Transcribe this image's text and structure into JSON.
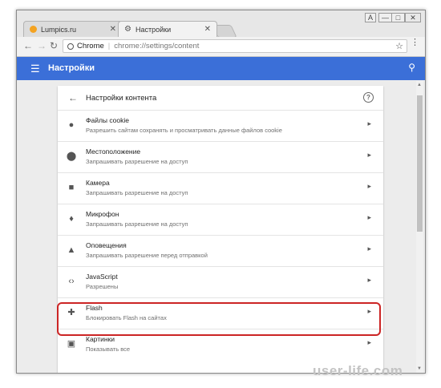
{
  "tabs": [
    {
      "title": "Lumpics.ru",
      "favicon": "lumpics-favicon-icon",
      "active": false,
      "color": "#f4a321"
    },
    {
      "title": "Настройки",
      "favicon": "gear-icon",
      "active": true
    }
  ],
  "window_controls": {
    "user": "A",
    "minimize": "—",
    "maximize": "□",
    "close": "✕"
  },
  "toolbar": {
    "site_name": "Chrome",
    "url": "chrome://settings/content",
    "separator": "|"
  },
  "header": {
    "title": "Настройки"
  },
  "card": {
    "title": "Настройки контента"
  },
  "rows": [
    {
      "icon": "cookie-icon",
      "label": "Файлы cookie",
      "desc": "Разрешить сайтам сохранять и просматривать данные файлов cookie"
    },
    {
      "icon": "location-pin-icon",
      "label": "Местоположение",
      "desc": "Запрашивать разрешение на доступ"
    },
    {
      "icon": "camera-icon",
      "label": "Камера",
      "desc": "Запрашивать разрешение на доступ"
    },
    {
      "icon": "microphone-icon",
      "label": "Микрофон",
      "desc": "Запрашивать разрешение на доступ"
    },
    {
      "icon": "bell-icon",
      "label": "Оповещения",
      "desc": "Запрашивать разрешение перед отправкой"
    },
    {
      "icon": "code-icon",
      "label": "JavaScript",
      "desc": "Разрешены"
    },
    {
      "icon": "puzzle-icon",
      "label": "Flash",
      "desc": "Блокировать Flash на сайтах"
    },
    {
      "icon": "image-icon",
      "label": "Картинки",
      "desc": "Показывать все"
    }
  ],
  "highlighted_row": "Flash",
  "colors": {
    "header": "#3b6fd8",
    "highlight": "#cc2525"
  },
  "watermark": "user-life.com"
}
